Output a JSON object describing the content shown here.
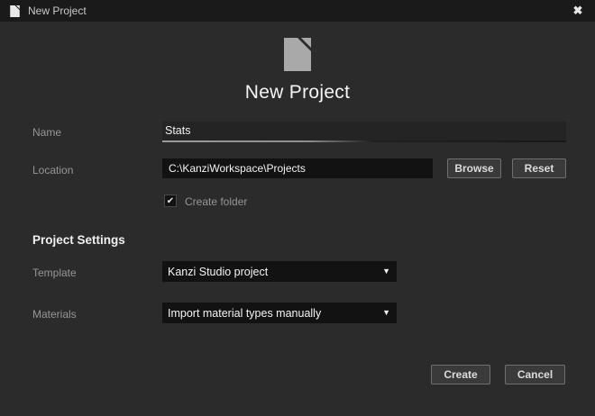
{
  "window": {
    "title": "New Project",
    "close_glyph": "✖"
  },
  "header": {
    "title": "New Project"
  },
  "form": {
    "name": {
      "label": "Name",
      "value": "Stats"
    },
    "location": {
      "label": "Location",
      "value": "C:\\KanziWorkspace\\Projects",
      "browse_label": "Browse",
      "reset_label": "Reset"
    },
    "create_folder": {
      "label": "Create folder",
      "checked": true,
      "check_glyph": "✔"
    },
    "settings_heading": "Project Settings",
    "template": {
      "label": "Template",
      "value": "Kanzi Studio project",
      "caret_glyph": "▼"
    },
    "materials": {
      "label": "Materials",
      "value": "Import material types manually",
      "caret_glyph": "▼"
    }
  },
  "footer": {
    "create_label": "Create",
    "cancel_label": "Cancel"
  },
  "colors": {
    "titlebar_bg": "#1a1a1a",
    "dialog_bg": "#2b2b2b",
    "field_bg": "#121212",
    "button_bg": "#3a3a3a",
    "button_border": "#6f6f6f",
    "label_text": "#969696",
    "value_text": "#f2f2f2",
    "icon_gray": "#a9a9a9"
  }
}
